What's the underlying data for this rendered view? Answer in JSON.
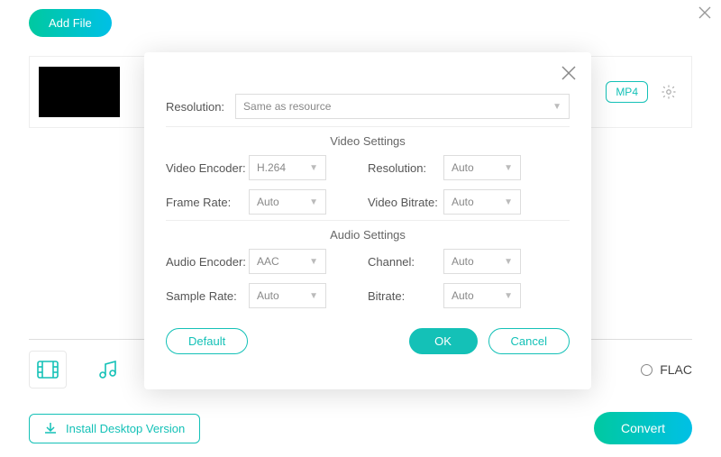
{
  "toolbar": {
    "add_file": "Add File"
  },
  "file_row": {
    "format_badge": "MP4"
  },
  "tabs": {
    "flac": "FLAC"
  },
  "footer": {
    "install": "Install Desktop Version",
    "convert": "Convert"
  },
  "modal": {
    "resolution_label": "Resolution:",
    "resolution_value": "Same as resource",
    "video_section": "Video Settings",
    "audio_section": "Audio Settings",
    "video": {
      "encoder_label": "Video Encoder:",
      "encoder_value": "H.264",
      "framerate_label": "Frame Rate:",
      "framerate_value": "Auto",
      "resolution_label": "Resolution:",
      "resolution_value": "Auto",
      "bitrate_label": "Video Bitrate:",
      "bitrate_value": "Auto"
    },
    "audio": {
      "encoder_label": "Audio Encoder:",
      "encoder_value": "AAC",
      "samplerate_label": "Sample Rate:",
      "samplerate_value": "Auto",
      "channel_label": "Channel:",
      "channel_value": "Auto",
      "bitrate_label": "Bitrate:",
      "bitrate_value": "Auto"
    },
    "buttons": {
      "default_": "Default",
      "ok": "OK",
      "cancel": "Cancel"
    }
  }
}
